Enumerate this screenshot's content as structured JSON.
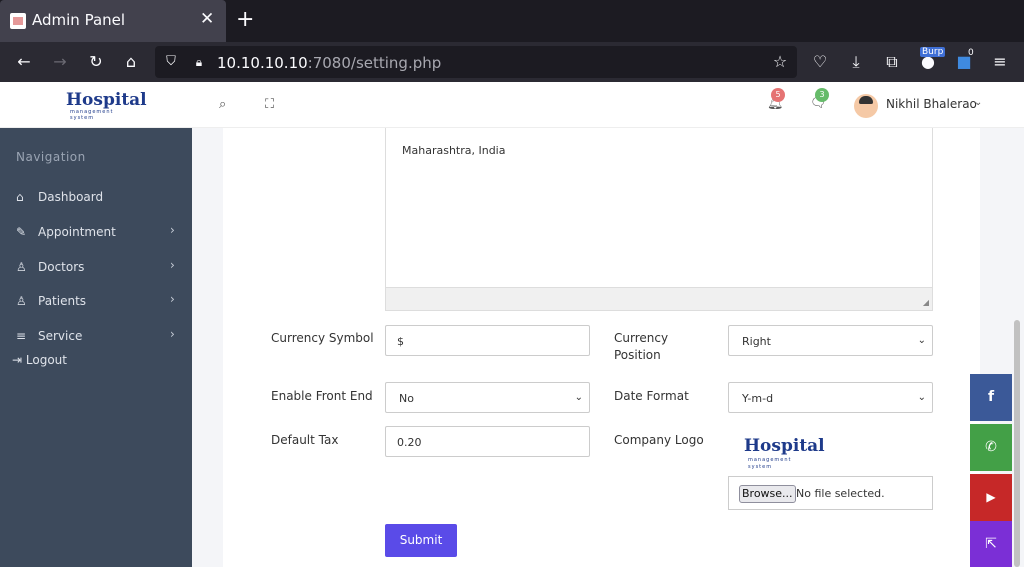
{
  "browser": {
    "tab_title": "Admin Panel",
    "url_host": "10.10.10.10",
    "url_rest": ":7080/setting.php",
    "burp_label": "Burp",
    "ext_badge": "0"
  },
  "header": {
    "logo_text": "Hospital",
    "logo_sub": "management system",
    "notif_count": "5",
    "msg_count": "3",
    "user_name": "Nikhil Bhalerao",
    "colors": {
      "notif": "#e57373",
      "msg": "#66bb6a"
    }
  },
  "sidebar": {
    "heading": "Navigation",
    "items": [
      {
        "label": "Dashboard",
        "icon": "home-icon",
        "has_sub": false
      },
      {
        "label": "Appointment",
        "icon": "edit-icon",
        "has_sub": true
      },
      {
        "label": "Doctors",
        "icon": "user-icon",
        "has_sub": true
      },
      {
        "label": "Patients",
        "icon": "user-icon",
        "has_sub": true
      },
      {
        "label": "Service",
        "icon": "menu-icon",
        "has_sub": true
      }
    ],
    "logout": "Logout"
  },
  "form": {
    "address_text": "Maharashtra, India",
    "currency_symbol_label": "Currency Symbol",
    "currency_symbol_value": "$",
    "currency_position_label": "Currency Position",
    "currency_position_value": "Right",
    "enable_front_end_label": "Enable Front End",
    "enable_front_end_value": "No",
    "date_format_label": "Date Format",
    "date_format_value": "Y-m-d",
    "default_tax_label": "Default Tax",
    "default_tax_value": "0.20",
    "company_logo_label": "Company Logo",
    "browse_label": "Browse...",
    "no_file_text": "No file selected.",
    "submit_label": "Submit"
  },
  "social": [
    {
      "icon": "facebook-icon",
      "color": "#3b5998"
    },
    {
      "icon": "whatsapp-icon",
      "color": "#43a047"
    },
    {
      "icon": "youtube-icon",
      "color": "#c62828"
    },
    {
      "icon": "external-link-icon",
      "color": "#7b2fd6"
    }
  ]
}
